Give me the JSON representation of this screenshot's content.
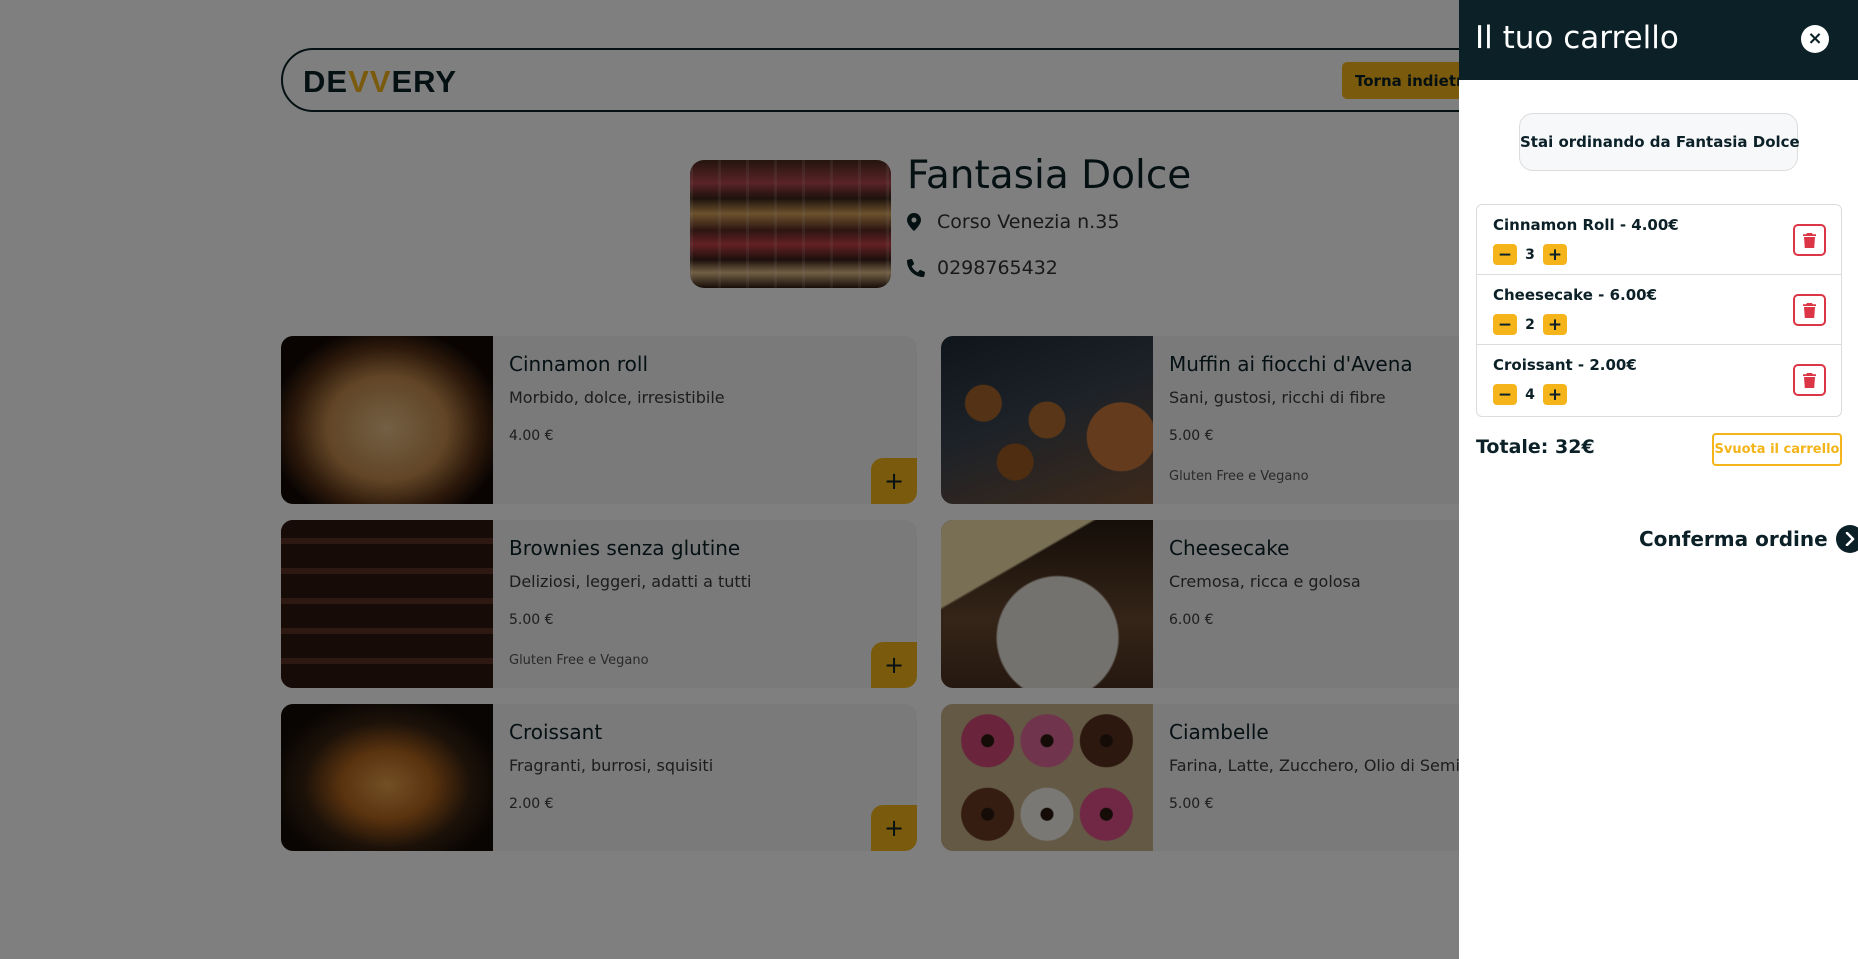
{
  "navbar": {
    "logo_prefix": "DE",
    "logo_v": "VV",
    "logo_suffix": "ERY",
    "back_label": "Torna indietro"
  },
  "restaurant": {
    "name": "Fantasia Dolce",
    "address": "Corso Venezia n.35",
    "phone": "0298765432"
  },
  "menu": [
    {
      "title": "Cinnamon roll",
      "desc": "Morbido, dolce, irresistibile",
      "price": "4.00 €",
      "tag": ""
    },
    {
      "title": "Muffin ai fiocchi d'Avena",
      "desc": "Sani, gustosi, ricchi di fibre",
      "price": "5.00 €",
      "tag": "Gluten Free e Vegano"
    },
    {
      "title": "Brownies senza glutine",
      "desc": "Deliziosi, leggeri, adatti a tutti",
      "price": "5.00 €",
      "tag": "Gluten Free e Vegano"
    },
    {
      "title": "Cheesecake",
      "desc": "Cremosa, ricca e golosa",
      "price": "6.00 €",
      "tag": ""
    },
    {
      "title": "Croissant",
      "desc": "Fragranti, burrosi, squisiti",
      "price": "2.00 €",
      "tag": ""
    },
    {
      "title": "Ciambelle",
      "desc": "Farina, Latte, Zucchero, Olio di Semi",
      "price": "5.00 €",
      "tag": ""
    }
  ],
  "add_symbol": "+",
  "cart": {
    "title": "Il tuo carrello",
    "close_symbol": "×",
    "ordering_from": "Stai ordinando da Fantasia Dolce",
    "items": [
      {
        "label": "Cinnamon Roll - 4.00€",
        "qty": "3"
      },
      {
        "label": "Cheesecake - 6.00€",
        "qty": "2"
      },
      {
        "label": "Croissant - 2.00€",
        "qty": "4"
      }
    ],
    "minus": "−",
    "plus": "+",
    "total": "Totale: 32€",
    "empty_label": "Svuota il carrello",
    "confirm_label": "Conferma ordine"
  },
  "colors": {
    "primary": "#0b2027",
    "accent": "#f4b41a",
    "danger": "#dc3545"
  }
}
